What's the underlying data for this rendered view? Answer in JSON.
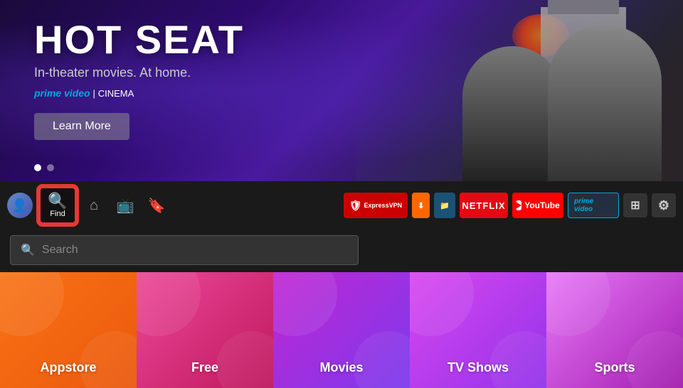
{
  "hero": {
    "title": "HOT SEAT",
    "subtitle": "In-theater movies. At home.",
    "brand": "prime video",
    "brand_separator": "|",
    "brand_type": "CINEMA",
    "learn_more": "Learn More",
    "dots": [
      {
        "active": true
      },
      {
        "active": false
      }
    ]
  },
  "nav": {
    "find_label": "Find",
    "icons": {
      "home": "⌂",
      "tv": "📺",
      "bookmark": "🔖"
    },
    "apps": [
      {
        "name": "ExpressVPN",
        "type": "expressvpn"
      },
      {
        "name": "Downloader",
        "type": "downloader"
      },
      {
        "name": "FileManager",
        "type": "blue"
      },
      {
        "name": "NETFLIX",
        "type": "netflix"
      },
      {
        "name": "YouTube",
        "type": "youtube"
      },
      {
        "name": "prime video",
        "type": "prime"
      },
      {
        "name": "Grid",
        "type": "grid"
      },
      {
        "name": "Settings",
        "type": "gear"
      }
    ]
  },
  "search": {
    "placeholder": "Search"
  },
  "categories": [
    {
      "label": "Appstore",
      "type": "appstore"
    },
    {
      "label": "Free",
      "type": "free"
    },
    {
      "label": "Movies",
      "type": "movies"
    },
    {
      "label": "TV Shows",
      "type": "tvshows"
    },
    {
      "label": "Sports",
      "type": "sports"
    }
  ]
}
